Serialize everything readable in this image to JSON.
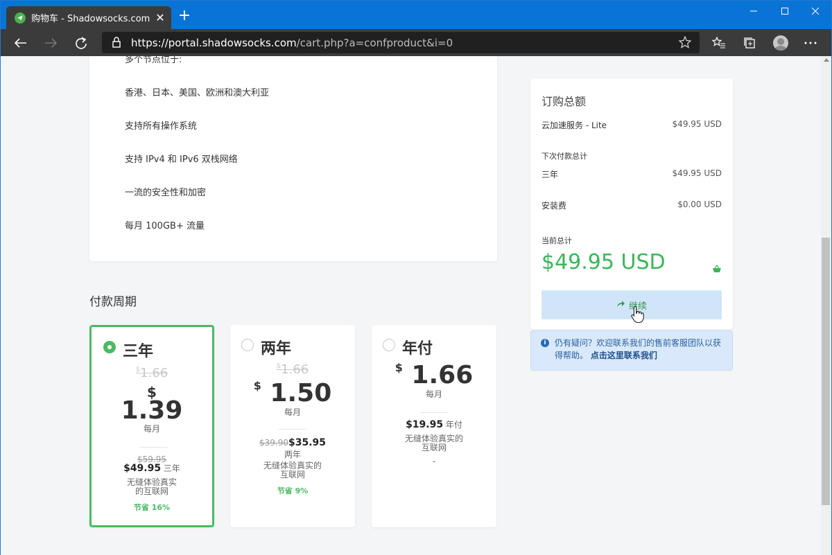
{
  "browser": {
    "tab_title": "购物车 - Shadowsocks.com",
    "url_host": "https://portal.shadowsocks.com",
    "url_path": "/cart.php?a=confproduct&i=0",
    "accent": "#0a74d6"
  },
  "features": {
    "items": [
      "多个节点位于:",
      "香港、日本、美国、欧洲和澳大利亚",
      "支持所有操作系统",
      "支持 IPv4 和 IPv6 双栈网络",
      "一流的安全性和加密",
      "每月 100GB+ 流量"
    ]
  },
  "billing": {
    "section_title": "付款周期",
    "plans": [
      {
        "name": "三年",
        "selected": true,
        "old_currency": "$",
        "old_price": "1.66",
        "currency": "$",
        "price": "1.39",
        "per": "每月",
        "old_total": "$59.95",
        "total": "$49.95",
        "total_suffix": "三年",
        "desc_line1": "无缝体验真实",
        "desc_line2": "的互联网",
        "save": "节省 16%"
      },
      {
        "name": "两年",
        "selected": false,
        "old_currency": "$",
        "old_price": "1.66",
        "currency": "$",
        "price": "1.50",
        "per": "每月",
        "old_total": "$39.90",
        "total": "$35.95",
        "total_suffix": "两年",
        "desc_line1": "无缝体验真实的",
        "desc_line2": "互联网",
        "save": "节省 9%"
      },
      {
        "name": "年付",
        "selected": false,
        "currency": "$",
        "price": "1.66",
        "per": "每月",
        "total": "$19.95",
        "total_suffix": "年付",
        "desc_line1": "无缝体验真实的",
        "desc_line2": "互联网",
        "dash": "-"
      }
    ]
  },
  "summary": {
    "title": "订购总额",
    "product": "云加速服务 - Lite",
    "product_price": "$49.95 USD",
    "next_label": "下次付款总计",
    "term": "三年",
    "term_price": "$49.95 USD",
    "setup": "安装费",
    "setup_price": "$0.00 USD",
    "current_label": "当前总计",
    "total": "$49.95 USD",
    "continue": "继续",
    "total_color": "#3cb55a"
  },
  "help": {
    "text": "仍有疑问？欢迎联系我们的售前客服团队以获得帮助。",
    "link": "点击这里联系我们"
  }
}
